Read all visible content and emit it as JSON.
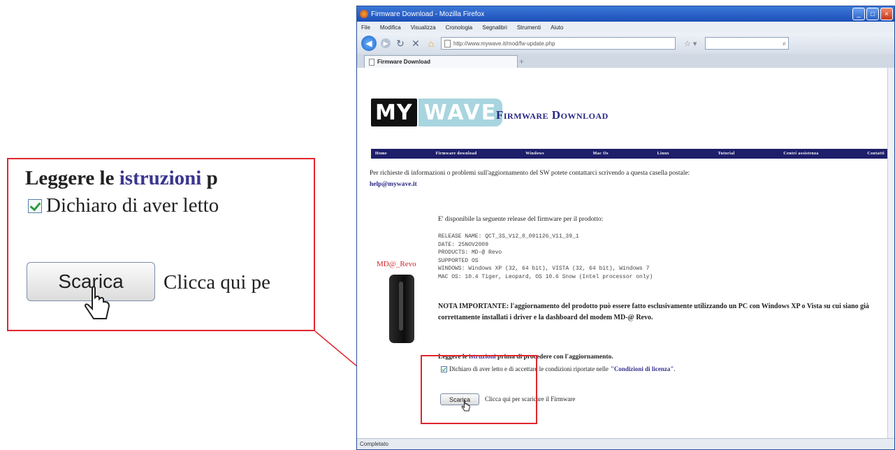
{
  "callout": {
    "line1_prefix": "Leggere le",
    "line1_link": "istruzioni",
    "line1_suffix": "p",
    "line2": "Dichiaro di aver letto",
    "button": "Scarica",
    "after_button": "Clicca qui pe"
  },
  "window": {
    "title": "Firmware Download - Mozilla Firefox",
    "menu": [
      "File",
      "Modifica",
      "Visualizza",
      "Cronologia",
      "Segnalibri",
      "Strumenti",
      "Aiuto"
    ],
    "url": "http://www.mywave.it/mod/fw-update.php",
    "tab_title": "Firmware Download",
    "status": "Completato"
  },
  "page": {
    "logo_my": "MY",
    "logo_wave": "WAVE",
    "heading": "Firmware Download",
    "nav": [
      "Home",
      "Firmware download",
      "Windows",
      "Mac Os",
      "Linux",
      "Tutorial",
      "Centri assistenza",
      "Contatti"
    ],
    "info_text": "Per richieste di informazioni o problemi sull'aggiornamento del SW potete contattarci scrivendo a questa casella postale:",
    "info_email": "help@mywave.it",
    "available": "E' disponibile la seguente release del firmware per il prodotto:",
    "release_lines": [
      "RELEASE NAME: QCT_3S_V12_0_091126_V11_39_1",
      "DATE: 25NOV2009",
      "PRODUCTS: MD-@ Revo",
      "SUPPORTED OS",
      "WINDOWS: Windows XP (32, 64 bit), VISTA (32, 64 bit), Windows 7",
      "MAC OS: 10.4 Tiger, Leopard, OS 10.6 Snow (Intel processor only)"
    ],
    "product_name": "MD@_Revo",
    "note": "NOTA IMPORTANTE: l'aggiornamento del prodotto può essere fatto esclusivamente utilizzando un PC con Windows XP o Vista su cui siano già correttamente installati i driver e la dashboard del modem MD-@ Revo.",
    "read_prefix": "Leggere le",
    "read_link": "istruzioni",
    "read_suffix": "prima di procedere con l'aggiornamento.",
    "declare_text": "Dichiaro di aver letto e di accettare le condizioni riportate nelle",
    "license_link": "\"Condizioni di licenza\"",
    "declare_end": ".",
    "download_button": "Scarica",
    "download_text": "Clicca qui per scaricare il Firmware"
  },
  "colors": {
    "highlight": "#e0262d",
    "nav_bg": "#1e1e6a",
    "link": "#3a3590"
  }
}
